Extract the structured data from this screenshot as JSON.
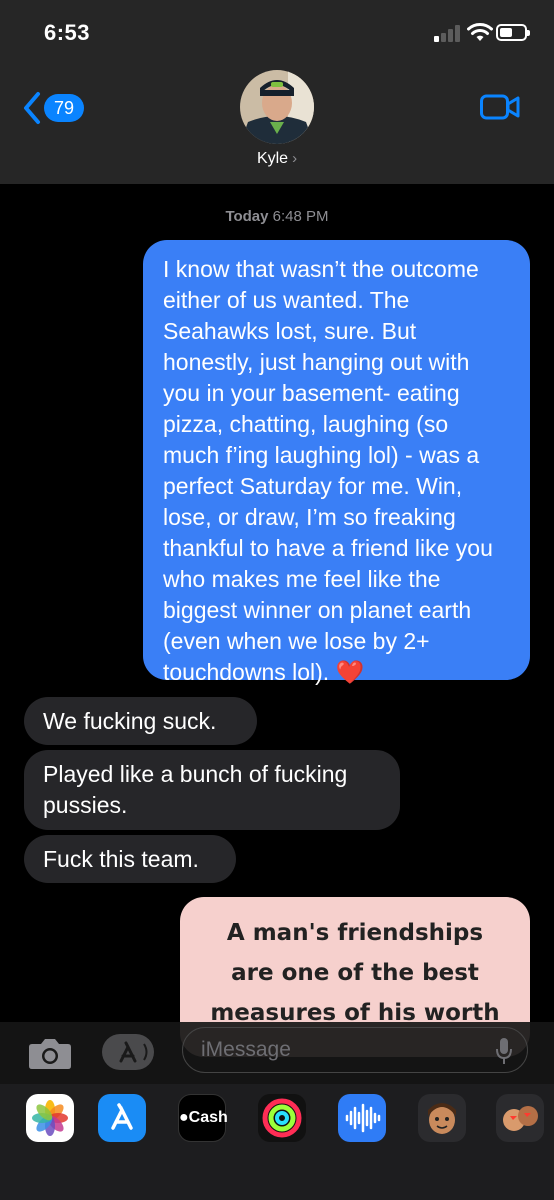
{
  "status_bar": {
    "time": "6:53"
  },
  "header": {
    "back_count": "79",
    "contact_name": "Kyle",
    "contact_chevron": "›"
  },
  "thread": {
    "timestamp_day": "Today",
    "timestamp_time": "6:48 PM",
    "messages": [
      {
        "type": "sent",
        "text": "I know that wasn’t the outcome either of us wanted. The Seahawks lost, sure. But honestly, just hanging out with you in your basement- eating pizza, chatting, laughing (so much f’ing laughing lol) - was a perfect Saturday for me. Win, lose, or draw, I’m so freaking thankful to have a friend like you who makes me feel like the biggest winner on planet earth (even when we lose by 2+ touchdowns lol). ❤️"
      },
      {
        "type": "received",
        "text": "We fucking suck."
      },
      {
        "type": "received",
        "text": "Played like a bunch of fucking pussies."
      },
      {
        "type": "received",
        "text": "Fuck this team."
      }
    ],
    "image_card_lines": [
      "A man's friendships",
      "are one of the best",
      "measures of his worth"
    ]
  },
  "composer": {
    "placeholder": "iMessage"
  },
  "dock": {
    "apps": [
      {
        "name": "Photos",
        "icon": "photos-icon"
      },
      {
        "name": "App Store",
        "icon": "app-store-icon"
      },
      {
        "name": "Cash",
        "label": "Cash",
        "icon": "apple-cash-icon"
      },
      {
        "name": "Activity",
        "icon": "activity-rings-icon"
      },
      {
        "name": "Audio Message",
        "icon": "audio-waveform-icon"
      },
      {
        "name": "Memoji",
        "icon": "memoji-icon"
      },
      {
        "name": "Memoji Stickers",
        "icon": "memoji-stickers-icon"
      }
    ]
  },
  "colors": {
    "sent_bubble": "#3a7ff6",
    "received_bubble": "#262629",
    "accent": "#0a84ff",
    "card_bg": "#f6d0cd"
  }
}
